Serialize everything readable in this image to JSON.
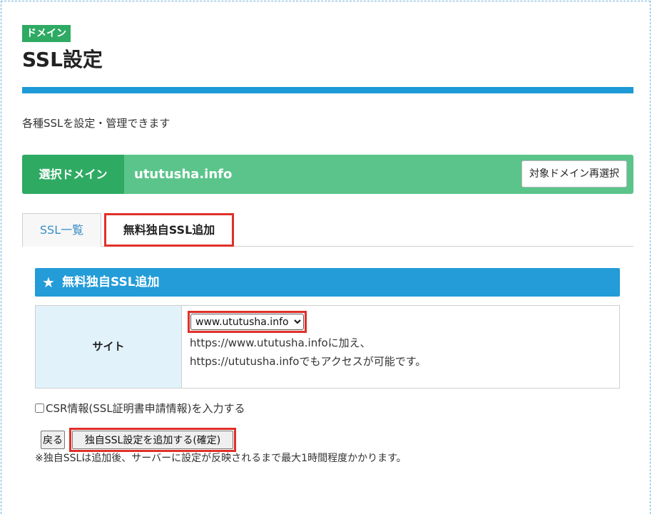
{
  "category_badge": "ドメイン",
  "page_title": "SSL設定",
  "description": "各種SSLを設定・管理できます",
  "domain_bar": {
    "label": "選択ドメイン",
    "value": "ututusha.info",
    "reselect_button": "対象ドメイン再選択"
  },
  "tabs": [
    {
      "label": "SSL一覧",
      "active": false
    },
    {
      "label": "無料独自SSL追加",
      "active": true
    }
  ],
  "panel": {
    "icon": "star-icon",
    "title": "無料独自SSL追加"
  },
  "form": {
    "site_label": "サイト",
    "site_select_value": "www.ututusha.info",
    "site_note_line1": "https://www.ututusha.infoに加え、",
    "site_note_line2": "https://ututusha.infoでもアクセスが可能です。"
  },
  "csr_checkbox_label": "CSR情報(SSL証明書申請情報)を入力する",
  "buttons": {
    "back": "戻る",
    "submit": "独自SSL設定を追加する(確定)"
  },
  "footnote": "※独自SSLは追加後、サーバーに設定が反映されるまで最大1時間程度かかります。",
  "colors": {
    "brand_green": "#2eaa63",
    "light_green": "#5bc48a",
    "accent_blue": "#1e9ad6",
    "highlight_red": "#e0302a",
    "label_cell_bg": "#e2f2fb"
  }
}
